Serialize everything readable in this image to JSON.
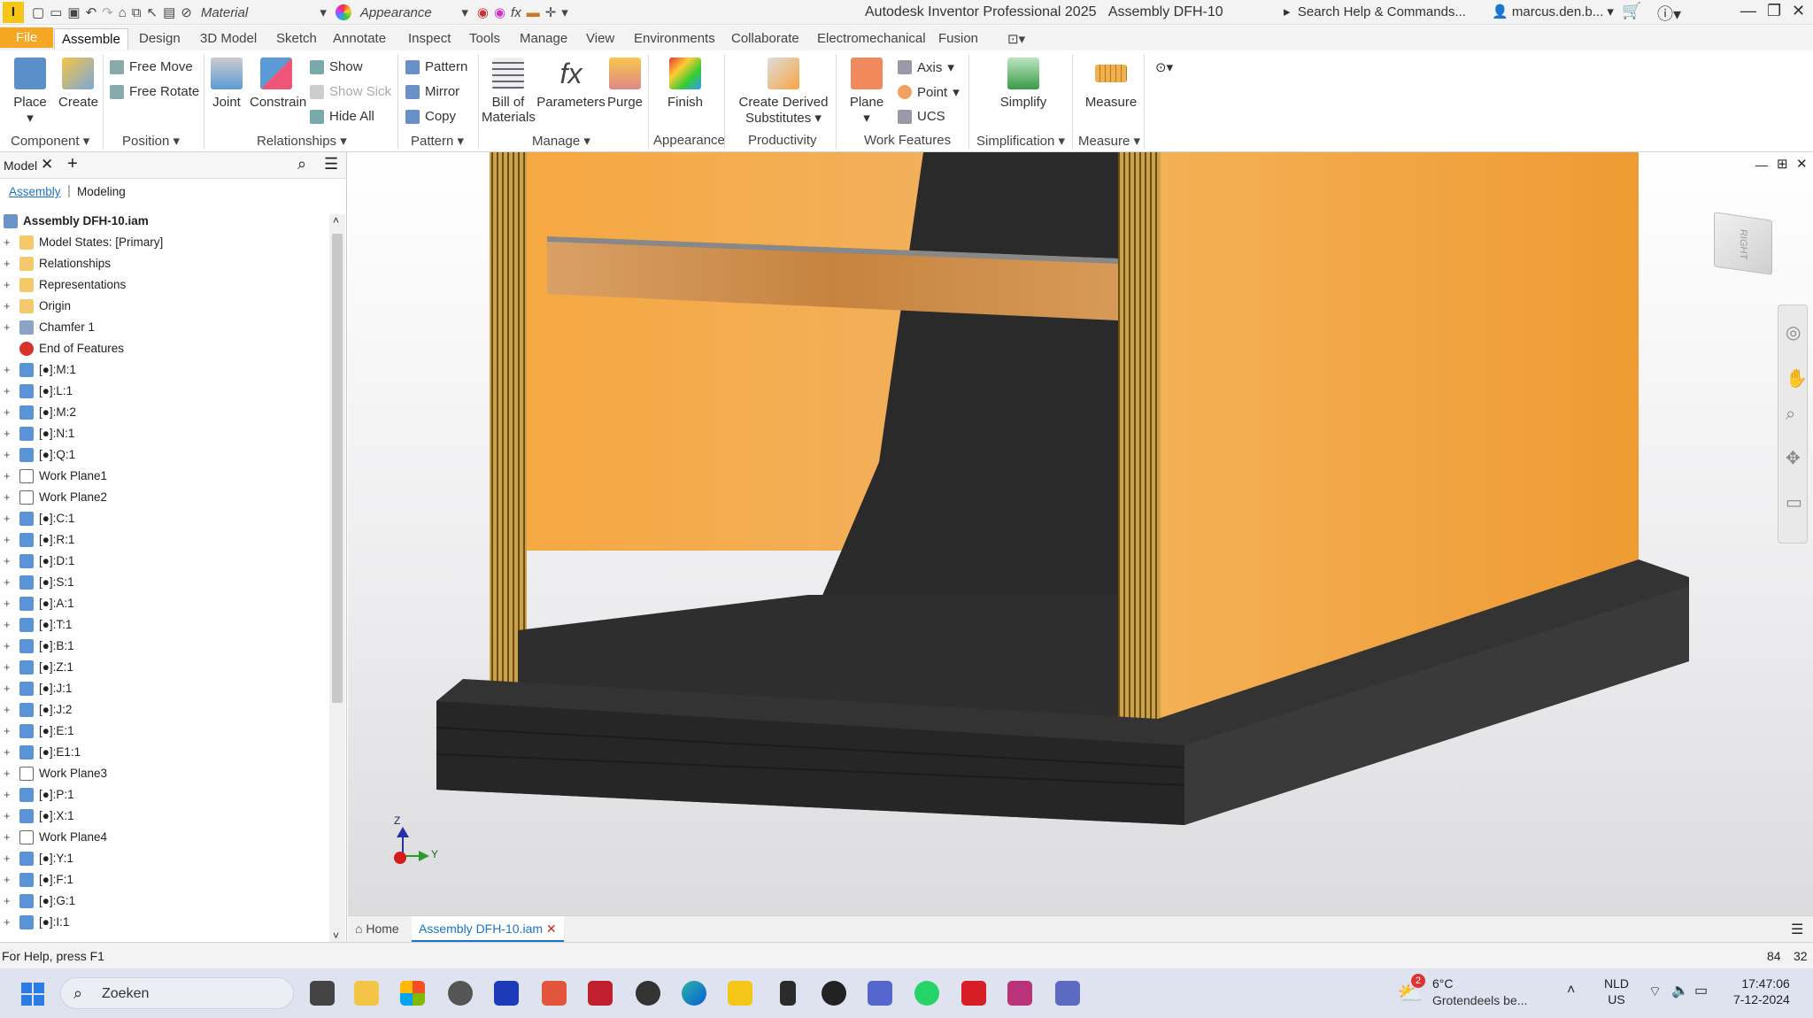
{
  "titlebar": {
    "app_title": "Autodesk Inventor Professional 2025",
    "doc_title": "Assembly DFH-10",
    "search_placeholder": "Search Help & Commands...",
    "user": "marcus.den.b...",
    "material_combo": "Material",
    "appearance_combo": "Appearance"
  },
  "tabs": [
    "File",
    "Assemble",
    "Design",
    "3D Model",
    "Sketch",
    "Annotate",
    "Inspect",
    "Tools",
    "Manage",
    "View",
    "Environments",
    "Collaborate",
    "Electromechanical",
    "Fusion"
  ],
  "ribbon": {
    "place": "Place",
    "create": "Create",
    "free_move": "Free Move",
    "free_rotate": "Free Rotate",
    "joint": "Joint",
    "constrain": "Constrain",
    "show": "Show",
    "show_sick": "Show Sick",
    "hide_all": "Hide All",
    "pattern": "Pattern",
    "mirror": "Mirror",
    "copy": "Copy",
    "bom_1": "Bill of",
    "bom_2": "Materials",
    "parameters": "Parameters",
    "purge": "Purge",
    "finish": "Finish",
    "derived_1": "Create Derived",
    "derived_2": "Substitutes",
    "plane": "Plane",
    "axis": "Axis",
    "point": "Point",
    "ucs": "UCS",
    "simplify": "Simplify",
    "measure": "Measure",
    "panels": {
      "component": "Component",
      "position": "Position",
      "relationships": "Relationships",
      "pattern": "Pattern",
      "manage": "Manage",
      "appearance": "Appearance",
      "productivity": "Productivity",
      "work_features": "Work Features",
      "simplification": "Simplification",
      "measure": "Measure"
    }
  },
  "browser": {
    "title": "Model",
    "tab_assembly": "Assembly",
    "tab_modeling": "Modeling",
    "root": "Assembly DFH-10.iam",
    "nodes": [
      "Model States: [Primary]",
      "Relationships",
      "Representations",
      "Origin",
      "Chamfer 1",
      "End of Features",
      "[●]:M:1",
      "[●]:L:1",
      "[●]:M:2",
      "[●]:N:1",
      "[●]:Q:1",
      "Work Plane1",
      "Work Plane2",
      "[●]:C:1",
      "[●]:R:1",
      "[●]:D:1",
      "[●]:S:1",
      "[●]:A:1",
      "[●]:T:1",
      "[●]:B:1",
      "[●]:Z:1",
      "[●]:J:1",
      "[●]:J:2",
      "[●]:E:1",
      "[●]:E1:1",
      "Work Plane3",
      "[●]:P:1",
      "[●]:X:1",
      "Work Plane4",
      "[●]:Y:1",
      "[●]:F:1",
      "[●]:G:1",
      "[●]:I:1"
    ]
  },
  "viewcube": "RIGHT",
  "triad": {
    "z": "Z",
    "y": "Y"
  },
  "doc_tabs": {
    "home": "Home",
    "active": "Assembly DFH-10.iam"
  },
  "status": {
    "help": "For Help, press F1",
    "n1": "84",
    "n2": "32"
  },
  "taskbar": {
    "search": "Zoeken",
    "weather_temp": "6°C",
    "weather_text": "Grotendeels be...",
    "weather_badge": "2",
    "lang1": "NLD",
    "lang2": "US",
    "time": "17:47:06",
    "date": "7-12-2024"
  }
}
